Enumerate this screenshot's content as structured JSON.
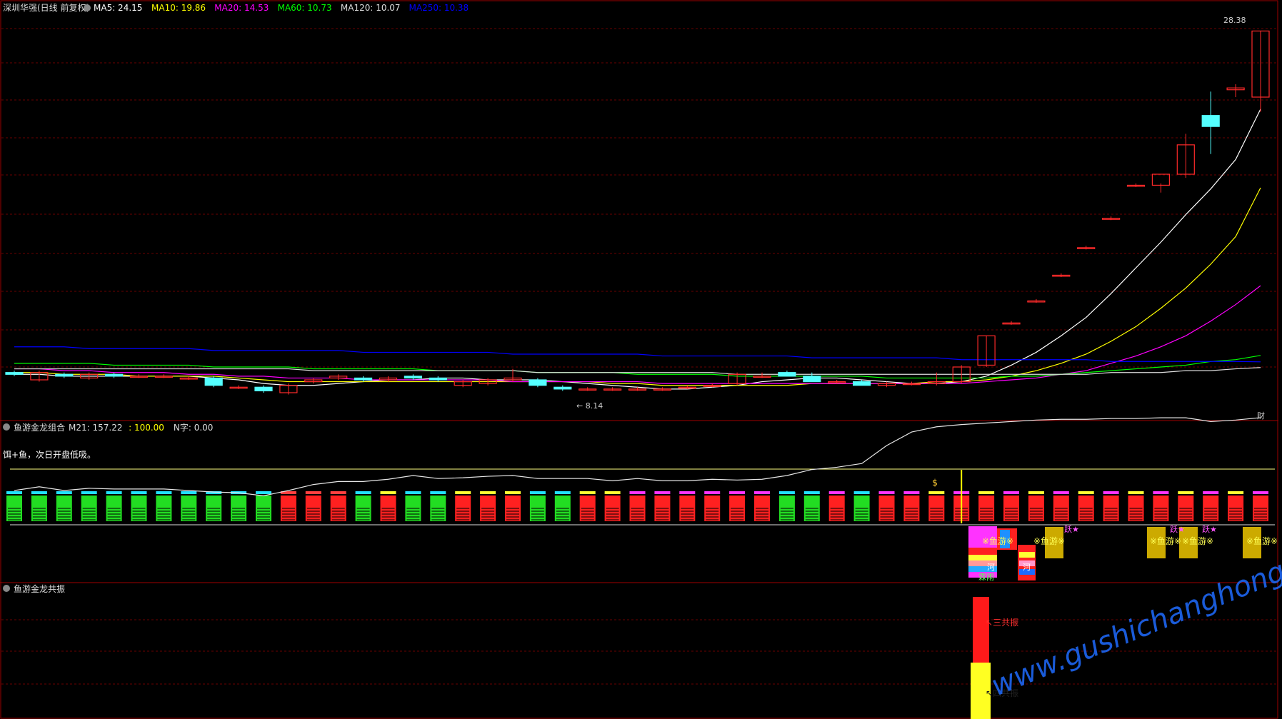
{
  "header": {
    "title": "深圳华强(日线 前复权)",
    "ma": [
      {
        "label": "MA5: 24.15",
        "color": "#ffffff"
      },
      {
        "label": "MA10: 19.86",
        "color": "#ffff00"
      },
      {
        "label": "MA20: 14.53",
        "color": "#ff00ff"
      },
      {
        "label": "MA60: 10.73",
        "color": "#00ff00"
      },
      {
        "label": "MA120: 10.07",
        "color": "#dddddd"
      },
      {
        "label": "MA250: 10.38",
        "color": "#0000ff"
      }
    ]
  },
  "price_panel": {
    "high_label": "28.38",
    "low_label": "8.14",
    "corner_label": "财",
    "colors": {
      "up": "#ff2a2a",
      "down": "#54ffff",
      "ma5": "#ffffff",
      "ma10": "#ffff00",
      "ma20": "#ff00ff",
      "ma60": "#00ff00",
      "ma120": "#dddddd",
      "ma250": "#0000ff"
    }
  },
  "indicator1": {
    "name": "鱼游金龙组合",
    "values": [
      {
        "label": "M21: 157.22",
        "color": "#dddddd"
      },
      {
        "label": ": 100.00",
        "color": "#ffff00"
      },
      {
        "label": "N字: 0.00",
        "color": "#dddddd"
      }
    ],
    "note": "饵+鱼，次日开盘低吸。",
    "sig_fish": "※鱼游※",
    "sig_jump": "跃★",
    "sig_money": "$",
    "sig_rain": "霖雨",
    "sig_he": "河"
  },
  "indicator2": {
    "name": "鱼游金龙共振",
    "label_three": "三共振",
    "label_four": "四共振"
  },
  "watermark": "www.gushichanghong.com",
  "chart_data": {
    "type": "candlestick",
    "title": "深圳华强(日线 前复权)",
    "candles": [
      {
        "o": 9.8,
        "h": 9.9,
        "l": 9.6,
        "c": 9.7
      },
      {
        "o": 9.4,
        "h": 9.9,
        "l": 9.3,
        "c": 9.8
      },
      {
        "o": 9.7,
        "h": 9.8,
        "l": 9.5,
        "c": 9.6
      },
      {
        "o": 9.5,
        "h": 9.8,
        "l": 9.4,
        "c": 9.7
      },
      {
        "o": 9.7,
        "h": 9.8,
        "l": 9.5,
        "c": 9.6
      },
      {
        "o": 9.6,
        "h": 9.7,
        "l": 9.5,
        "c": 9.6
      },
      {
        "o": 9.6,
        "h": 9.7,
        "l": 9.5,
        "c": 9.6
      },
      {
        "o": 9.5,
        "h": 9.6,
        "l": 9.4,
        "c": 9.5
      },
      {
        "o": 9.5,
        "h": 9.6,
        "l": 9.0,
        "c": 9.1
      },
      {
        "o": 9.0,
        "h": 9.1,
        "l": 8.9,
        "c": 9.0
      },
      {
        "o": 9.0,
        "h": 9.1,
        "l": 8.7,
        "c": 8.8
      },
      {
        "o": 8.7,
        "h": 9.2,
        "l": 8.6,
        "c": 9.1
      },
      {
        "o": 9.3,
        "h": 9.5,
        "l": 9.2,
        "c": 9.4
      },
      {
        "o": 9.5,
        "h": 9.7,
        "l": 9.4,
        "c": 9.6
      },
      {
        "o": 9.5,
        "h": 9.6,
        "l": 9.3,
        "c": 9.4
      },
      {
        "o": 9.4,
        "h": 9.6,
        "l": 9.3,
        "c": 9.5
      },
      {
        "o": 9.6,
        "h": 9.7,
        "l": 9.4,
        "c": 9.5
      },
      {
        "o": 9.5,
        "h": 9.6,
        "l": 9.3,
        "c": 9.4
      },
      {
        "o": 9.1,
        "h": 9.4,
        "l": 9.0,
        "c": 9.3
      },
      {
        "o": 9.2,
        "h": 9.5,
        "l": 9.1,
        "c": 9.4
      },
      {
        "o": 9.4,
        "h": 10.0,
        "l": 9.3,
        "c": 9.5
      },
      {
        "o": 9.4,
        "h": 9.5,
        "l": 9.0,
        "c": 9.1
      },
      {
        "o": 9.0,
        "h": 9.1,
        "l": 8.8,
        "c": 8.9
      },
      {
        "o": 8.9,
        "h": 9.0,
        "l": 8.8,
        "c": 8.9
      },
      {
        "o": 8.9,
        "h": 9.0,
        "l": 8.8,
        "c": 8.9
      },
      {
        "o": 8.9,
        "h": 9.0,
        "l": 8.8,
        "c": 8.9
      },
      {
        "o": 8.9,
        "h": 9.0,
        "l": 8.8,
        "c": 8.9
      },
      {
        "o": 9.0,
        "h": 9.1,
        "l": 8.9,
        "c": 9.0
      },
      {
        "o": 9.1,
        "h": 9.2,
        "l": 9.0,
        "c": 9.1
      },
      {
        "o": 9.2,
        "h": 9.8,
        "l": 9.1,
        "c": 9.7
      },
      {
        "o": 9.6,
        "h": 9.8,
        "l": 9.5,
        "c": 9.6
      },
      {
        "o": 9.8,
        "h": 9.9,
        "l": 9.6,
        "c": 9.6
      },
      {
        "o": 9.6,
        "h": 9.8,
        "l": 9.5,
        "c": 9.3
      },
      {
        "o": 9.3,
        "h": 9.4,
        "l": 9.2,
        "c": 9.3
      },
      {
        "o": 9.3,
        "h": 9.4,
        "l": 9.1,
        "c": 9.1
      },
      {
        "o": 9.1,
        "h": 9.3,
        "l": 9.0,
        "c": 9.2
      },
      {
        "o": 9.2,
        "h": 9.3,
        "l": 9.1,
        "c": 9.2
      },
      {
        "o": 9.2,
        "h": 9.8,
        "l": 9.1,
        "c": 9.3
      },
      {
        "o": 9.3,
        "h": 10.2,
        "l": 9.2,
        "c": 10.1
      },
      {
        "o": 10.2,
        "h": 11.8,
        "l": 10.1,
        "c": 11.8
      },
      {
        "o": 12.5,
        "h": 12.6,
        "l": 12.4,
        "c": 12.5
      },
      {
        "o": 13.7,
        "h": 13.8,
        "l": 13.6,
        "c": 13.7
      },
      {
        "o": 15.1,
        "h": 15.2,
        "l": 15.0,
        "c": 15.1
      },
      {
        "o": 16.6,
        "h": 16.7,
        "l": 16.5,
        "c": 16.6
      },
      {
        "o": 18.2,
        "h": 18.3,
        "l": 18.1,
        "c": 18.2
      },
      {
        "o": 20.0,
        "h": 20.1,
        "l": 19.9,
        "c": 20.0
      },
      {
        "o": 20.0,
        "h": 20.1,
        "l": 19.6,
        "c": 20.6
      },
      {
        "o": 20.6,
        "h": 22.8,
        "l": 20.4,
        "c": 22.2
      },
      {
        "o": 23.8,
        "h": 25.1,
        "l": 21.7,
        "c": 23.2
      },
      {
        "o": 25.2,
        "h": 25.5,
        "l": 24.8,
        "c": 25.3
      },
      {
        "o": 24.8,
        "h": 28.4,
        "l": 24.0,
        "c": 28.4
      }
    ],
    "ma_series": [
      {
        "name": "MA5",
        "values": [
          9.7,
          9.7,
          9.6,
          9.6,
          9.6,
          9.6,
          9.6,
          9.6,
          9.5,
          9.4,
          9.2,
          9.1,
          9.1,
          9.2,
          9.3,
          9.4,
          9.4,
          9.5,
          9.5,
          9.4,
          9.4,
          9.4,
          9.3,
          9.2,
          9.1,
          9.0,
          8.9,
          8.9,
          9.0,
          9.1,
          9.3,
          9.4,
          9.5,
          9.5,
          9.4,
          9.3,
          9.2,
          9.2,
          9.3,
          9.6,
          10.2,
          10.9,
          11.8,
          12.8,
          14.1,
          15.5,
          16.9,
          18.4,
          19.8,
          21.4,
          24.15
        ]
      },
      {
        "name": "MA10",
        "values": [
          9.8,
          9.8,
          9.7,
          9.7,
          9.7,
          9.6,
          9.6,
          9.6,
          9.6,
          9.5,
          9.4,
          9.3,
          9.3,
          9.3,
          9.3,
          9.3,
          9.3,
          9.3,
          9.3,
          9.3,
          9.3,
          9.3,
          9.3,
          9.3,
          9.2,
          9.2,
          9.1,
          9.1,
          9.1,
          9.1,
          9.1,
          9.1,
          9.2,
          9.2,
          9.2,
          9.2,
          9.2,
          9.3,
          9.3,
          9.4,
          9.6,
          9.9,
          10.3,
          10.8,
          11.5,
          12.3,
          13.3,
          14.4,
          15.7,
          17.2,
          19.86
        ]
      },
      {
        "name": "MA20",
        "values": [
          10.0,
          10.0,
          9.9,
          9.9,
          9.8,
          9.8,
          9.8,
          9.7,
          9.7,
          9.6,
          9.6,
          9.5,
          9.5,
          9.5,
          9.4,
          9.4,
          9.4,
          9.4,
          9.4,
          9.4,
          9.3,
          9.3,
          9.3,
          9.3,
          9.3,
          9.3,
          9.2,
          9.2,
          9.2,
          9.2,
          9.2,
          9.2,
          9.2,
          9.2,
          9.2,
          9.2,
          9.2,
          9.2,
          9.2,
          9.3,
          9.4,
          9.5,
          9.7,
          9.9,
          10.3,
          10.7,
          11.2,
          11.8,
          12.6,
          13.5,
          14.53
        ]
      },
      {
        "name": "MA60",
        "values": [
          10.3,
          10.3,
          10.3,
          10.3,
          10.2,
          10.2,
          10.2,
          10.2,
          10.1,
          10.1,
          10.1,
          10.1,
          10.0,
          10.0,
          10.0,
          10.0,
          10.0,
          9.9,
          9.9,
          9.9,
          9.9,
          9.8,
          9.8,
          9.8,
          9.8,
          9.7,
          9.7,
          9.7,
          9.7,
          9.6,
          9.6,
          9.6,
          9.6,
          9.6,
          9.6,
          9.5,
          9.5,
          9.5,
          9.5,
          9.5,
          9.6,
          9.6,
          9.7,
          9.8,
          9.9,
          10.0,
          10.1,
          10.2,
          10.4,
          10.5,
          10.73
        ]
      },
      {
        "name": "MA120",
        "values": [
          10.0,
          10.0,
          10.0,
          10.0,
          10.0,
          10.0,
          10.0,
          10.0,
          10.0,
          10.0,
          10.0,
          10.0,
          9.9,
          9.9,
          9.9,
          9.9,
          9.9,
          9.9,
          9.9,
          9.9,
          9.9,
          9.8,
          9.8,
          9.8,
          9.8,
          9.8,
          9.8,
          9.8,
          9.8,
          9.7,
          9.7,
          9.7,
          9.7,
          9.7,
          9.7,
          9.7,
          9.7,
          9.7,
          9.7,
          9.7,
          9.7,
          9.7,
          9.7,
          9.7,
          9.8,
          9.8,
          9.8,
          9.9,
          9.9,
          10.0,
          10.07
        ]
      },
      {
        "name": "MA250",
        "values": [
          11.2,
          11.2,
          11.2,
          11.1,
          11.1,
          11.1,
          11.1,
          11.1,
          11.0,
          11.0,
          11.0,
          11.0,
          11.0,
          11.0,
          10.9,
          10.9,
          10.9,
          10.9,
          10.9,
          10.9,
          10.8,
          10.8,
          10.8,
          10.8,
          10.8,
          10.8,
          10.7,
          10.7,
          10.7,
          10.7,
          10.7,
          10.7,
          10.6,
          10.6,
          10.6,
          10.6,
          10.6,
          10.6,
          10.5,
          10.5,
          10.5,
          10.5,
          10.5,
          10.5,
          10.4,
          10.4,
          10.4,
          10.4,
          10.4,
          10.4,
          10.38
        ]
      }
    ],
    "ylim": [
      8.0,
      29.0
    ],
    "indicator_line": [
      60,
      65,
      60,
      63,
      62,
      62,
      62,
      60,
      58,
      57,
      53,
      60,
      68,
      72,
      72,
      75,
      80,
      76,
      77,
      79,
      80,
      76,
      76,
      76,
      73,
      76,
      73,
      73,
      75,
      74,
      75,
      80,
      88,
      91,
      96,
      120,
      138,
      145,
      148,
      150,
      152,
      154,
      155,
      155,
      156,
      156,
      157,
      157,
      152,
      154,
      157.22
    ],
    "indicator_ylim": [
      0,
      200
    ]
  }
}
